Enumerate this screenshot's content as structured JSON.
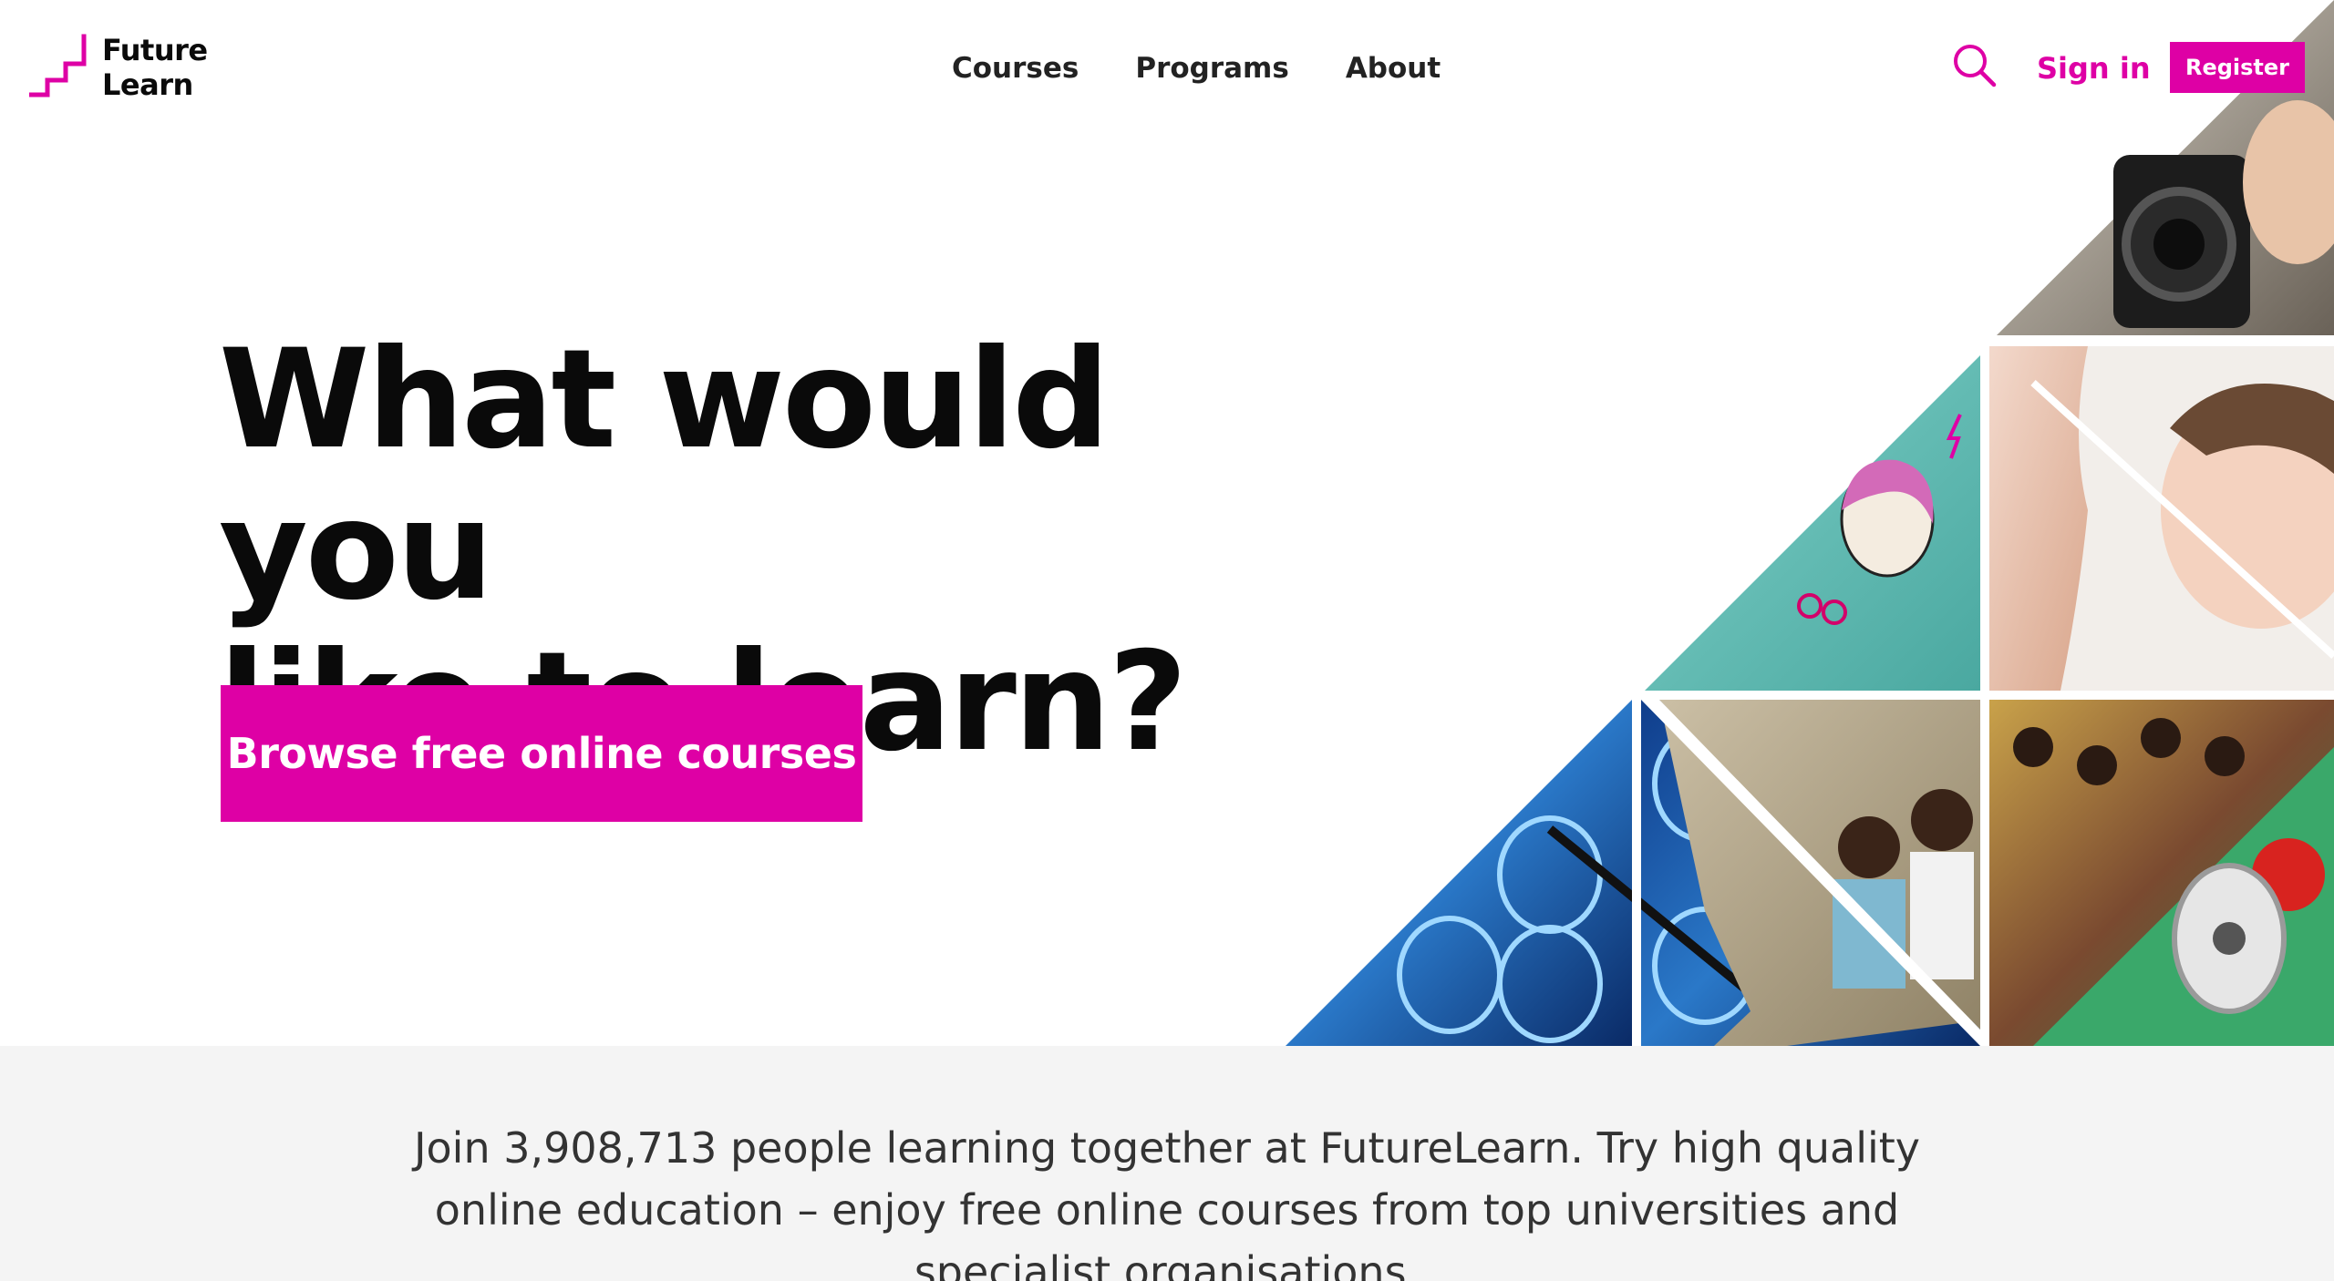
{
  "brand": {
    "name_line1": "Future",
    "name_line2": "Learn",
    "accent_color": "#de00a5",
    "logo_icon": "staircase-logo-icon"
  },
  "nav": {
    "items": [
      {
        "label": "Courses"
      },
      {
        "label": "Programs"
      },
      {
        "label": "About"
      }
    ]
  },
  "header_actions": {
    "search_icon": "search-icon",
    "sign_in_label": "Sign in",
    "register_label": "Register"
  },
  "hero": {
    "headline_line1": "What would you",
    "headline_line2": "like to learn?",
    "cta_label": "Browse free online courses",
    "mosaic_images": [
      "video-camera-photo",
      "cartoon-illustration-photo",
      "mother-and-baby-photo",
      "brain-scan-photo",
      "children-group-photo",
      "megaphone-photo"
    ]
  },
  "intro": {
    "text": "Join 3,908,713 people learning together at FutureLearn. Try high quality online education – enjoy free online courses from top universities and specialist organisations."
  }
}
